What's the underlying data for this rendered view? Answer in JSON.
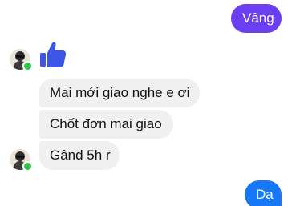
{
  "conversation": {
    "messages": [
      {
        "sender": "me",
        "text": "Vâng"
      },
      {
        "sender": "contact",
        "type": "like-sticker"
      },
      {
        "sender": "contact",
        "text": "Mai mới giao nghe e ơi"
      },
      {
        "sender": "contact",
        "text": "Chốt đơn mai giao"
      },
      {
        "sender": "contact",
        "text": "Gând 5h r"
      },
      {
        "sender": "me",
        "text": "Dạ"
      }
    ]
  },
  "colors": {
    "outgoing_purple": "#6a3ff0",
    "outgoing_blue": "#1677f7",
    "incoming_bubble": "#f0f0f0",
    "like_icon": "#3c55e6",
    "online_dot": "#31c24a"
  },
  "icons": {
    "like": "thumbs-up-icon",
    "presence": "online-status-dot"
  }
}
